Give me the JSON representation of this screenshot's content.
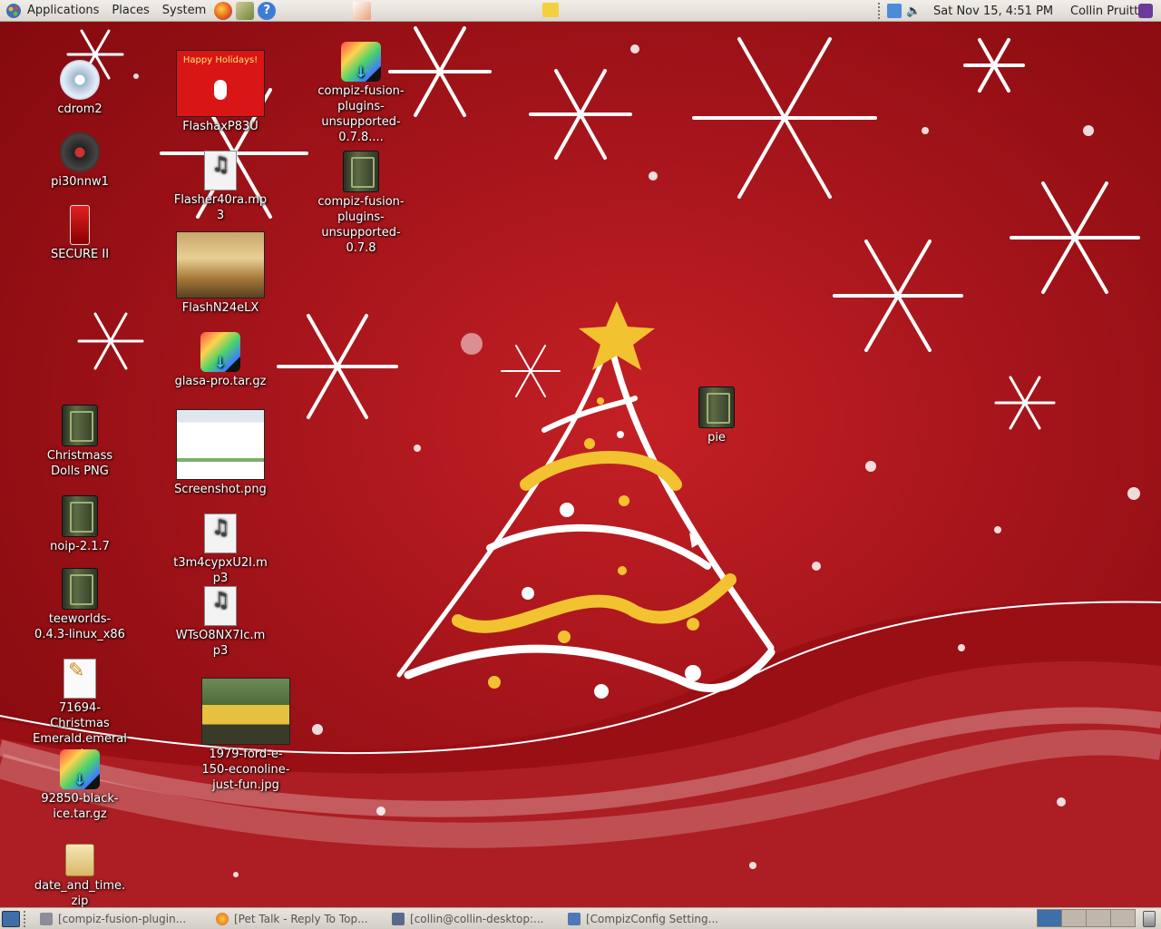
{
  "top_panel": {
    "menus": [
      "Applications",
      "Places",
      "System"
    ],
    "datetime": "Sat Nov 15,  4:51 PM",
    "user": "Collin Pruitt"
  },
  "desktop_icons": [
    {
      "label": "cdrom2",
      "type": "disc"
    },
    {
      "label": "pi30nnw1",
      "type": "dvd"
    },
    {
      "label": "SECURE II",
      "type": "usb"
    },
    {
      "label": "Christmass Dolls PNG",
      "type": "book"
    },
    {
      "label": "noip-2.1.7",
      "type": "book"
    },
    {
      "label": "teeworlds-0.4.3-linux_x86",
      "type": "book"
    },
    {
      "label": "71694-Christmas Emerald.emerald",
      "type": "document"
    },
    {
      "label": "92850-black-ice.tar.gz",
      "type": "archive"
    },
    {
      "label": "date_and_time.zip",
      "type": "zip"
    },
    {
      "label": "FlashaxP83U",
      "type": "image-holiday"
    },
    {
      "label": "Flasher40ra.mp3",
      "type": "music"
    },
    {
      "label": "FlashN24eLX",
      "type": "image-desert"
    },
    {
      "label": "glasa-pro.tar.gz",
      "type": "archive"
    },
    {
      "label": "Screenshot.png",
      "type": "image-screenshot"
    },
    {
      "label": "t3m4cypxU2I.mp3",
      "type": "music"
    },
    {
      "label": "WTsO8NX7Ic.mp3",
      "type": "music"
    },
    {
      "label": "1979-ford-e-150-econoline-just-fun.jpg",
      "type": "image-truck"
    },
    {
      "label": "compiz-fusion-plugins-unsupported-0.7.8....",
      "type": "archive"
    },
    {
      "label": "compiz-fusion-plugins-unsupported-0.7.8",
      "type": "book"
    },
    {
      "label": "pie",
      "type": "book"
    }
  ],
  "thumbnail_text": {
    "holiday": "Happy Holidays!"
  },
  "taskbar": {
    "tasks": [
      {
        "label": "[compiz-fusion-plugin...",
        "icon": "folder-icon"
      },
      {
        "label": "[Pet Talk - Reply To Top...",
        "icon": "firefox-icon"
      },
      {
        "label": "[collin@collin-desktop:...",
        "icon": "terminal-icon"
      },
      {
        "label": "[CompizConfig Setting...",
        "icon": "settings-icon"
      }
    ],
    "workspaces": 4
  },
  "colors": {
    "accent": "#c42025",
    "panel": "#e6e2db",
    "text_on_desktop": "#ffffff",
    "tree_gold": "#f2c230"
  }
}
